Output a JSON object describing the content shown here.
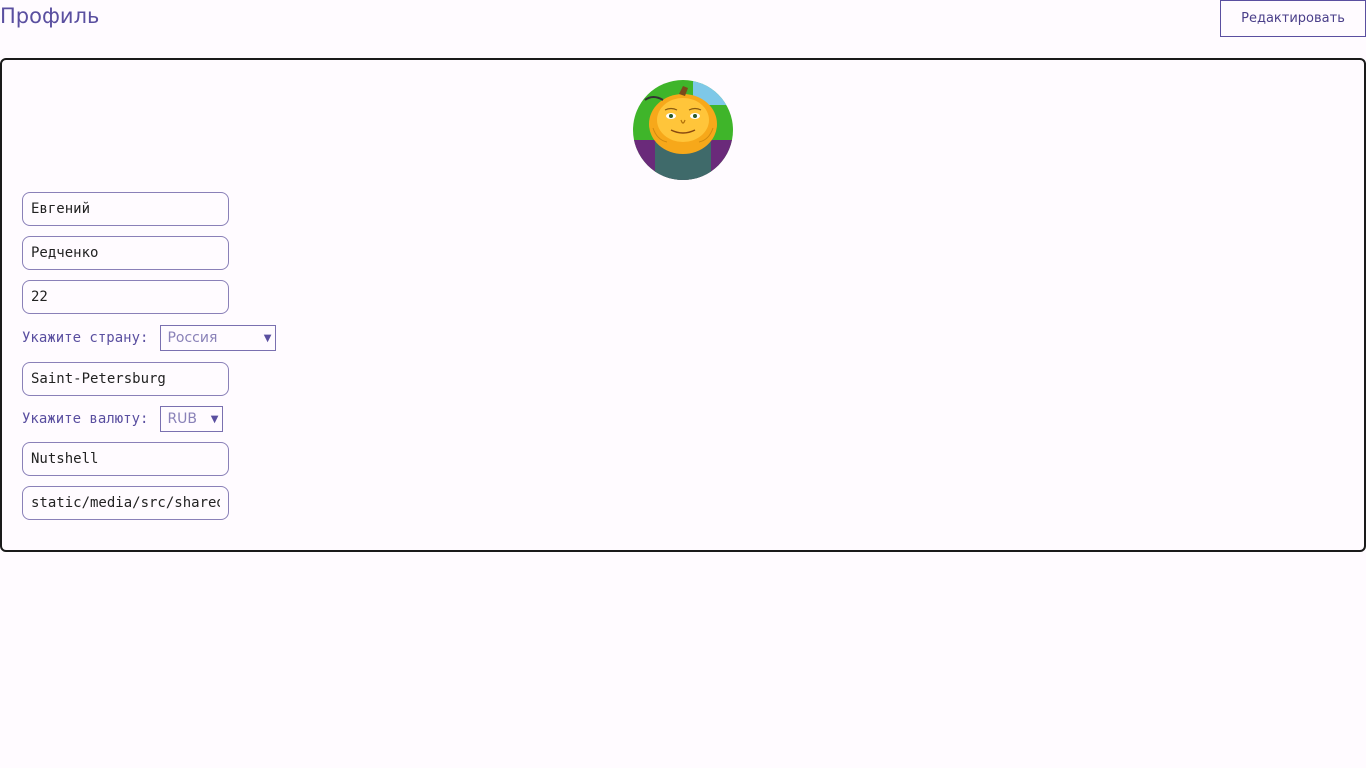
{
  "header": {
    "title": "Профиль",
    "edit_label": "Редактировать"
  },
  "profile": {
    "first_name": "Евгений",
    "last_name": "Редченко",
    "age": "22",
    "country": {
      "label": "Укажите страну:",
      "value": "Россия"
    },
    "city": "Saint-Petersburg",
    "currency": {
      "label": "Укажите валюту:",
      "value": "RUB"
    },
    "username": "Nutshell",
    "avatar_path": "static/media/src/shared/"
  },
  "colors": {
    "accent": "#5a4fa0",
    "background": "#fffbff",
    "border": "#1a1a1a"
  }
}
